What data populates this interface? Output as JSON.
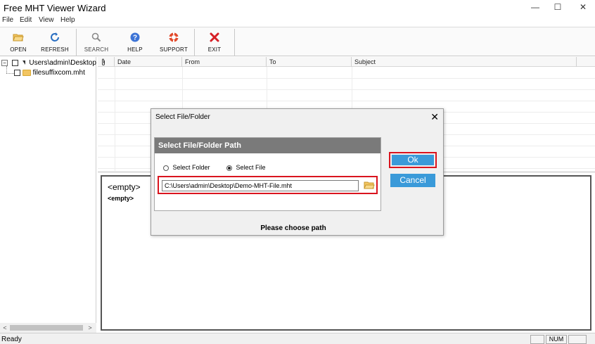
{
  "window": {
    "title": "Free MHT Viewer Wizard",
    "minimize": "—",
    "maximize": "☐",
    "close": "✕"
  },
  "menu": [
    "File",
    "Edit",
    "View",
    "Help"
  ],
  "toolbar": {
    "open": "OPEN",
    "refresh": "REFRESH",
    "search": "SEARCH",
    "help": "HELP",
    "support": "SUPPORT",
    "exit": "EXIT"
  },
  "tree": {
    "root": "Users\\admin\\Desktop",
    "child": "filesuffixcom.mht"
  },
  "grid": {
    "columns": [
      "Date",
      "From",
      "To",
      "Subject"
    ]
  },
  "preview": {
    "line1": "<empty>",
    "line2": "<empty>"
  },
  "dialog": {
    "title": "Select File/Folder",
    "close": "✕",
    "group_title": "Select File/Folder Path",
    "option_folder": "Select Folder",
    "option_file": "Select File",
    "selected_option": "Select File",
    "path_value": "C:\\Users\\admin\\Desktop\\Demo-MHT-File.mht",
    "ok": "Ok",
    "cancel": "Cancel",
    "hint": "Please choose path"
  },
  "statusbar": {
    "status": "Ready",
    "num": "NUM"
  },
  "colors": {
    "accent_button": "#3a9ad9",
    "highlight_border": "#d9141e",
    "group_header": "#7a7a7a"
  }
}
